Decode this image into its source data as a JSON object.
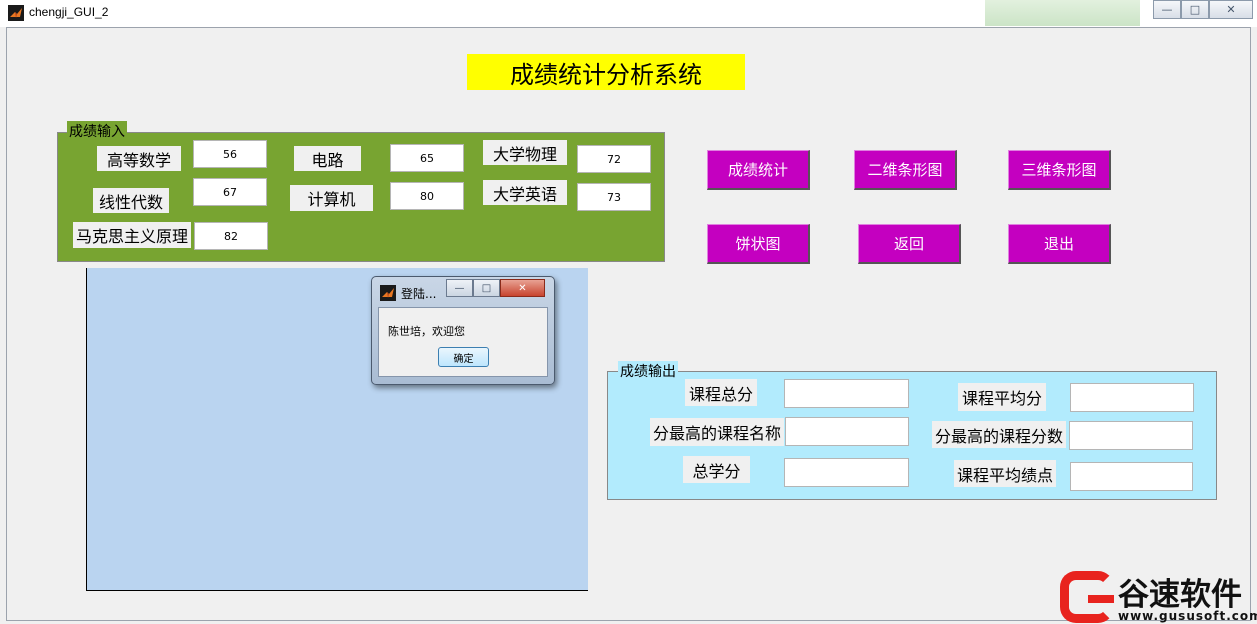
{
  "window": {
    "title": "chengji_GUI_2",
    "controls": [
      "minimize",
      "maximize",
      "close"
    ]
  },
  "main_title": "成绩统计分析系统",
  "input_panel": {
    "legend": "成绩输入",
    "fields": [
      {
        "label": "高等数学",
        "value": "56"
      },
      {
        "label": "线性代数",
        "value": "67"
      },
      {
        "label": "马克思主义原理",
        "value": "82"
      },
      {
        "label": "电路",
        "value": "65"
      },
      {
        "label": "计算机",
        "value": "80"
      },
      {
        "label": "大学物理",
        "value": "72"
      },
      {
        "label": "大学英语",
        "value": "73"
      }
    ]
  },
  "buttons": {
    "stats": "成绩统计",
    "bar2d": "二维条形图",
    "bar3d": "三维条形图",
    "pie": "饼状图",
    "back": "返回",
    "exit": "退出"
  },
  "output_panel": {
    "legend": "成绩输出",
    "fields": [
      {
        "label": "课程总分",
        "value": ""
      },
      {
        "label": "分最高的课程名称",
        "value": ""
      },
      {
        "label": "总学分",
        "value": ""
      },
      {
        "label": "课程平均分",
        "value": ""
      },
      {
        "label": "分最高的课程分数",
        "value": ""
      },
      {
        "label": "课程平均绩点",
        "value": ""
      }
    ]
  },
  "dialog": {
    "title": "登陆...",
    "message": "陈世培，欢迎您",
    "ok_label": "确定"
  },
  "watermark": {
    "text": "谷速软件",
    "url": "www.gususoft.com"
  },
  "colors": {
    "title_bg": "#ffff00",
    "input_panel_bg": "#78a431",
    "button_bg": "#c400c0",
    "axes_bg": "#bad4f0",
    "output_panel_bg": "#b2ebfd",
    "watermark_red": "#e8231e"
  },
  "icons": {
    "app": "matlab-icon"
  }
}
